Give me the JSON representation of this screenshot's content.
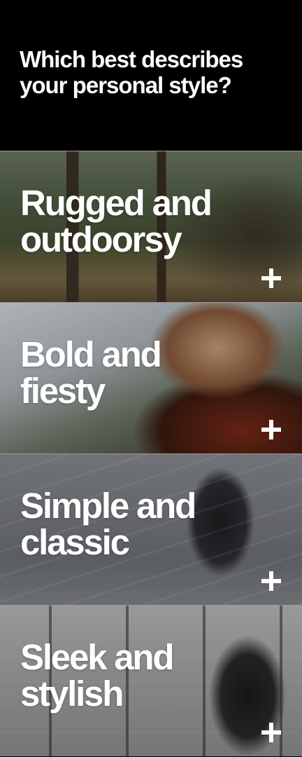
{
  "question": "Which best describes your personal style?",
  "options": [
    {
      "label": "Rugged and outdoorsy",
      "icon": "plus-icon"
    },
    {
      "label": "Bold and fiesty",
      "icon": "plus-icon"
    },
    {
      "label": "Simple and classic",
      "icon": "plus-icon"
    },
    {
      "label": "Sleek and stylish",
      "icon": "plus-icon"
    }
  ],
  "colors": {
    "background": "#000000",
    "text": "#ffffff",
    "divider": "#9a9a9a"
  }
}
